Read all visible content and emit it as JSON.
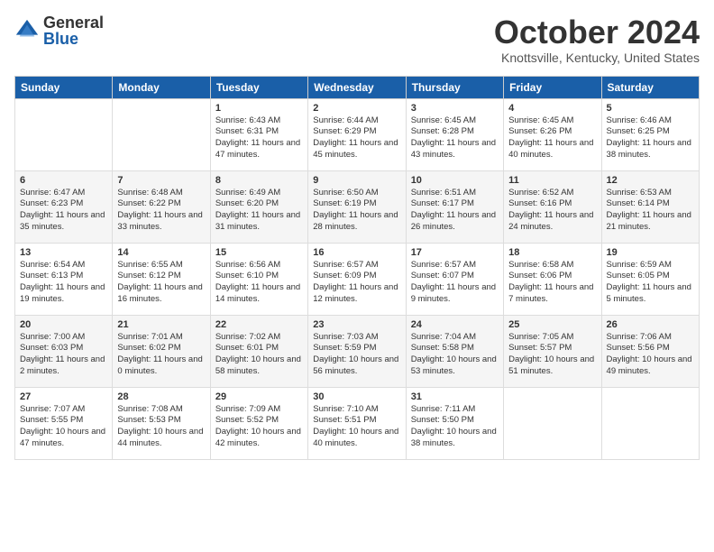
{
  "logo": {
    "general": "General",
    "blue": "Blue"
  },
  "title": "October 2024",
  "location": "Knottsville, Kentucky, United States",
  "headers": [
    "Sunday",
    "Monday",
    "Tuesday",
    "Wednesday",
    "Thursday",
    "Friday",
    "Saturday"
  ],
  "weeks": [
    [
      {
        "day": "",
        "sunrise": "",
        "sunset": "",
        "daylight": ""
      },
      {
        "day": "",
        "sunrise": "",
        "sunset": "",
        "daylight": ""
      },
      {
        "day": "1",
        "sunrise": "Sunrise: 6:43 AM",
        "sunset": "Sunset: 6:31 PM",
        "daylight": "Daylight: 11 hours and 47 minutes."
      },
      {
        "day": "2",
        "sunrise": "Sunrise: 6:44 AM",
        "sunset": "Sunset: 6:29 PM",
        "daylight": "Daylight: 11 hours and 45 minutes."
      },
      {
        "day": "3",
        "sunrise": "Sunrise: 6:45 AM",
        "sunset": "Sunset: 6:28 PM",
        "daylight": "Daylight: 11 hours and 43 minutes."
      },
      {
        "day": "4",
        "sunrise": "Sunrise: 6:45 AM",
        "sunset": "Sunset: 6:26 PM",
        "daylight": "Daylight: 11 hours and 40 minutes."
      },
      {
        "day": "5",
        "sunrise": "Sunrise: 6:46 AM",
        "sunset": "Sunset: 6:25 PM",
        "daylight": "Daylight: 11 hours and 38 minutes."
      }
    ],
    [
      {
        "day": "6",
        "sunrise": "Sunrise: 6:47 AM",
        "sunset": "Sunset: 6:23 PM",
        "daylight": "Daylight: 11 hours and 35 minutes."
      },
      {
        "day": "7",
        "sunrise": "Sunrise: 6:48 AM",
        "sunset": "Sunset: 6:22 PM",
        "daylight": "Daylight: 11 hours and 33 minutes."
      },
      {
        "day": "8",
        "sunrise": "Sunrise: 6:49 AM",
        "sunset": "Sunset: 6:20 PM",
        "daylight": "Daylight: 11 hours and 31 minutes."
      },
      {
        "day": "9",
        "sunrise": "Sunrise: 6:50 AM",
        "sunset": "Sunset: 6:19 PM",
        "daylight": "Daylight: 11 hours and 28 minutes."
      },
      {
        "day": "10",
        "sunrise": "Sunrise: 6:51 AM",
        "sunset": "Sunset: 6:17 PM",
        "daylight": "Daylight: 11 hours and 26 minutes."
      },
      {
        "day": "11",
        "sunrise": "Sunrise: 6:52 AM",
        "sunset": "Sunset: 6:16 PM",
        "daylight": "Daylight: 11 hours and 24 minutes."
      },
      {
        "day": "12",
        "sunrise": "Sunrise: 6:53 AM",
        "sunset": "Sunset: 6:14 PM",
        "daylight": "Daylight: 11 hours and 21 minutes."
      }
    ],
    [
      {
        "day": "13",
        "sunrise": "Sunrise: 6:54 AM",
        "sunset": "Sunset: 6:13 PM",
        "daylight": "Daylight: 11 hours and 19 minutes."
      },
      {
        "day": "14",
        "sunrise": "Sunrise: 6:55 AM",
        "sunset": "Sunset: 6:12 PM",
        "daylight": "Daylight: 11 hours and 16 minutes."
      },
      {
        "day": "15",
        "sunrise": "Sunrise: 6:56 AM",
        "sunset": "Sunset: 6:10 PM",
        "daylight": "Daylight: 11 hours and 14 minutes."
      },
      {
        "day": "16",
        "sunrise": "Sunrise: 6:57 AM",
        "sunset": "Sunset: 6:09 PM",
        "daylight": "Daylight: 11 hours and 12 minutes."
      },
      {
        "day": "17",
        "sunrise": "Sunrise: 6:57 AM",
        "sunset": "Sunset: 6:07 PM",
        "daylight": "Daylight: 11 hours and 9 minutes."
      },
      {
        "day": "18",
        "sunrise": "Sunrise: 6:58 AM",
        "sunset": "Sunset: 6:06 PM",
        "daylight": "Daylight: 11 hours and 7 minutes."
      },
      {
        "day": "19",
        "sunrise": "Sunrise: 6:59 AM",
        "sunset": "Sunset: 6:05 PM",
        "daylight": "Daylight: 11 hours and 5 minutes."
      }
    ],
    [
      {
        "day": "20",
        "sunrise": "Sunrise: 7:00 AM",
        "sunset": "Sunset: 6:03 PM",
        "daylight": "Daylight: 11 hours and 2 minutes."
      },
      {
        "day": "21",
        "sunrise": "Sunrise: 7:01 AM",
        "sunset": "Sunset: 6:02 PM",
        "daylight": "Daylight: 11 hours and 0 minutes."
      },
      {
        "day": "22",
        "sunrise": "Sunrise: 7:02 AM",
        "sunset": "Sunset: 6:01 PM",
        "daylight": "Daylight: 10 hours and 58 minutes."
      },
      {
        "day": "23",
        "sunrise": "Sunrise: 7:03 AM",
        "sunset": "Sunset: 5:59 PM",
        "daylight": "Daylight: 10 hours and 56 minutes."
      },
      {
        "day": "24",
        "sunrise": "Sunrise: 7:04 AM",
        "sunset": "Sunset: 5:58 PM",
        "daylight": "Daylight: 10 hours and 53 minutes."
      },
      {
        "day": "25",
        "sunrise": "Sunrise: 7:05 AM",
        "sunset": "Sunset: 5:57 PM",
        "daylight": "Daylight: 10 hours and 51 minutes."
      },
      {
        "day": "26",
        "sunrise": "Sunrise: 7:06 AM",
        "sunset": "Sunset: 5:56 PM",
        "daylight": "Daylight: 10 hours and 49 minutes."
      }
    ],
    [
      {
        "day": "27",
        "sunrise": "Sunrise: 7:07 AM",
        "sunset": "Sunset: 5:55 PM",
        "daylight": "Daylight: 10 hours and 47 minutes."
      },
      {
        "day": "28",
        "sunrise": "Sunrise: 7:08 AM",
        "sunset": "Sunset: 5:53 PM",
        "daylight": "Daylight: 10 hours and 44 minutes."
      },
      {
        "day": "29",
        "sunrise": "Sunrise: 7:09 AM",
        "sunset": "Sunset: 5:52 PM",
        "daylight": "Daylight: 10 hours and 42 minutes."
      },
      {
        "day": "30",
        "sunrise": "Sunrise: 7:10 AM",
        "sunset": "Sunset: 5:51 PM",
        "daylight": "Daylight: 10 hours and 40 minutes."
      },
      {
        "day": "31",
        "sunrise": "Sunrise: 7:11 AM",
        "sunset": "Sunset: 5:50 PM",
        "daylight": "Daylight: 10 hours and 38 minutes."
      },
      {
        "day": "",
        "sunrise": "",
        "sunset": "",
        "daylight": ""
      },
      {
        "day": "",
        "sunrise": "",
        "sunset": "",
        "daylight": ""
      }
    ]
  ]
}
